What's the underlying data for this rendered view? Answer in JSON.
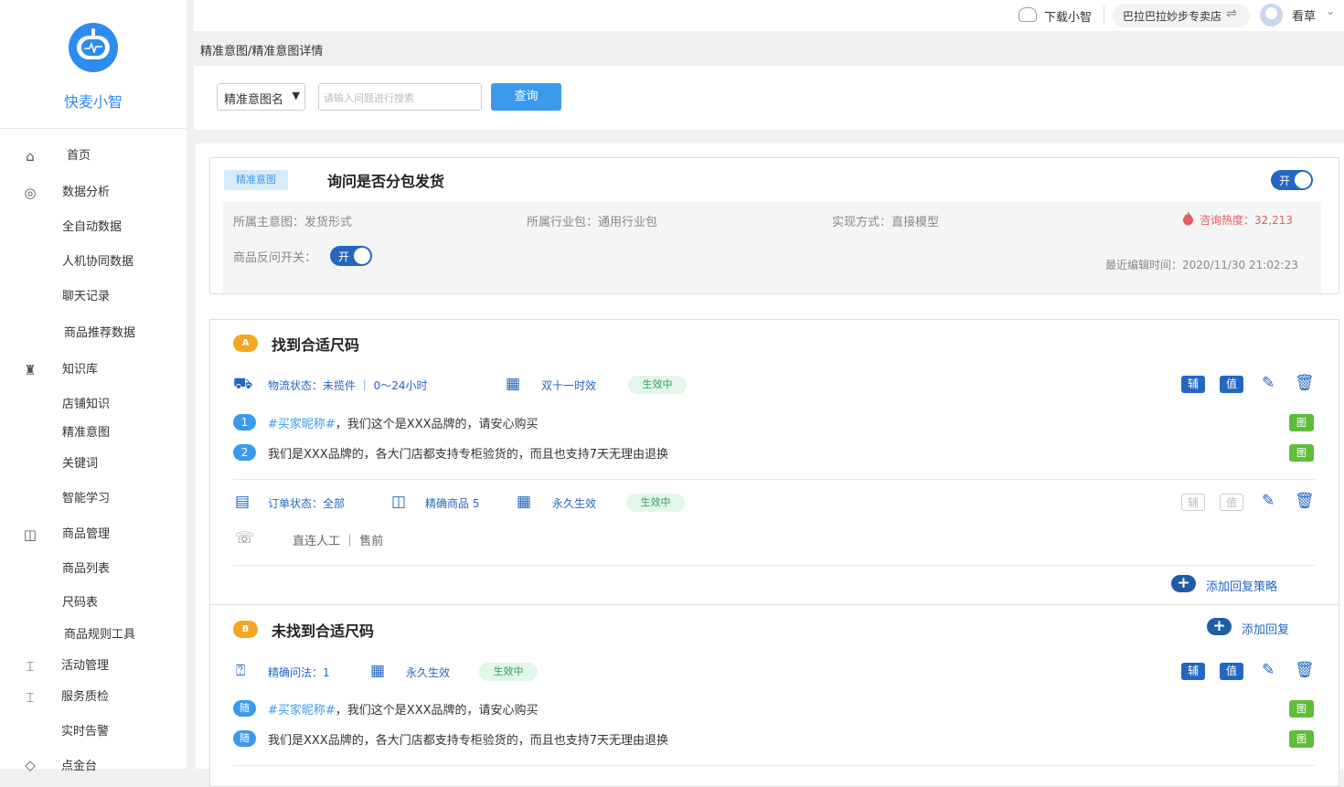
{
  "sidebar": {
    "brand": "快麦小智",
    "items": [
      {
        "label": "首页",
        "icon": "home-icon"
      },
      {
        "label": "数据分析",
        "icon": "chart-icon"
      },
      {
        "label": "全自动数据"
      },
      {
        "label": "人机协同数据"
      },
      {
        "label": "聊天记录"
      },
      {
        "label": "商品推荐数据"
      },
      {
        "label": "知识库",
        "icon": "knowledge-icon"
      },
      {
        "label": "店铺知识"
      },
      {
        "label": "精准意图"
      },
      {
        "label": "关键词"
      },
      {
        "label": "智能学习"
      },
      {
        "label": "商品管理",
        "icon": "bag-icon"
      },
      {
        "label": "商品列表"
      },
      {
        "label": "尺码表"
      },
      {
        "label": "商品规则工具"
      },
      {
        "label": "活动管理",
        "icon": "activity-icon"
      },
      {
        "label": "服务质检",
        "icon": "quality-icon"
      },
      {
        "label": "实时告警"
      },
      {
        "label": "点金台",
        "icon": "gold-icon"
      }
    ]
  },
  "topbar": {
    "download": "下载小智",
    "store": "巴拉巴拉妙步专卖店",
    "user": "看草"
  },
  "breadcrumb": "精准意图/精准意图详情",
  "search": {
    "select_value": "精准意图名",
    "placeholder": "请输入问题进行搜索",
    "button": "查询"
  },
  "intent": {
    "tag": "精准意图",
    "title": "询问是否分包发货",
    "toggle": "开",
    "main_intent": "所属主意图：发货形式",
    "industry": "所属行业包：通用行业包",
    "method": "实现方式：直接模型",
    "heat": "咨询热度：32,213",
    "reverse_label": "商品反问开关：",
    "reverse_toggle": "开",
    "edit_time": "最近编辑时间：2020/11/30 21:02:23"
  },
  "section_a": {
    "badge": "A",
    "title": "找到合适尺码",
    "strategy1": {
      "logistics": "物流状态：未揽件 ｜ 0～24小时",
      "date": "双十一时效",
      "status": "生效中",
      "btn_aux": "辅",
      "btn_val": "值",
      "replies": [
        {
          "index": "1",
          "highlight": "#买家昵称#",
          "text": "，我们这个是XXX品牌的，请安心购买",
          "tag": "图"
        },
        {
          "index": "2",
          "highlight": "",
          "text": "我们是XXX品牌的，各大门店都支持专柜验货的，而且也支持7天无理由退换",
          "tag": "图"
        }
      ]
    },
    "strategy2": {
      "order": "订单状态：全部",
      "goods": "精确商品 5",
      "date": "永久生效",
      "status": "生效中",
      "btn_aux": "辅",
      "btn_val": "值",
      "transfer": "直连人工 ｜ 售前"
    },
    "add_strategy": "添加回复策略"
  },
  "section_b": {
    "badge": "B",
    "title": "未找到合适尺码",
    "add_reply": "添加回复",
    "question": "精确问法：1",
    "date": "永久生效",
    "status": "生效中",
    "btn_aux": "辅",
    "btn_val": "值",
    "replies": [
      {
        "index": "随",
        "highlight": "#买家昵称#",
        "text": "，我们这个是XXX品牌的，请安心购买",
        "tag": "图"
      },
      {
        "index": "随",
        "highlight": "",
        "text": "我们是XXX品牌的，各大门店都支持专柜验货的，而且也支持7天无理由退换",
        "tag": "图"
      }
    ]
  }
}
